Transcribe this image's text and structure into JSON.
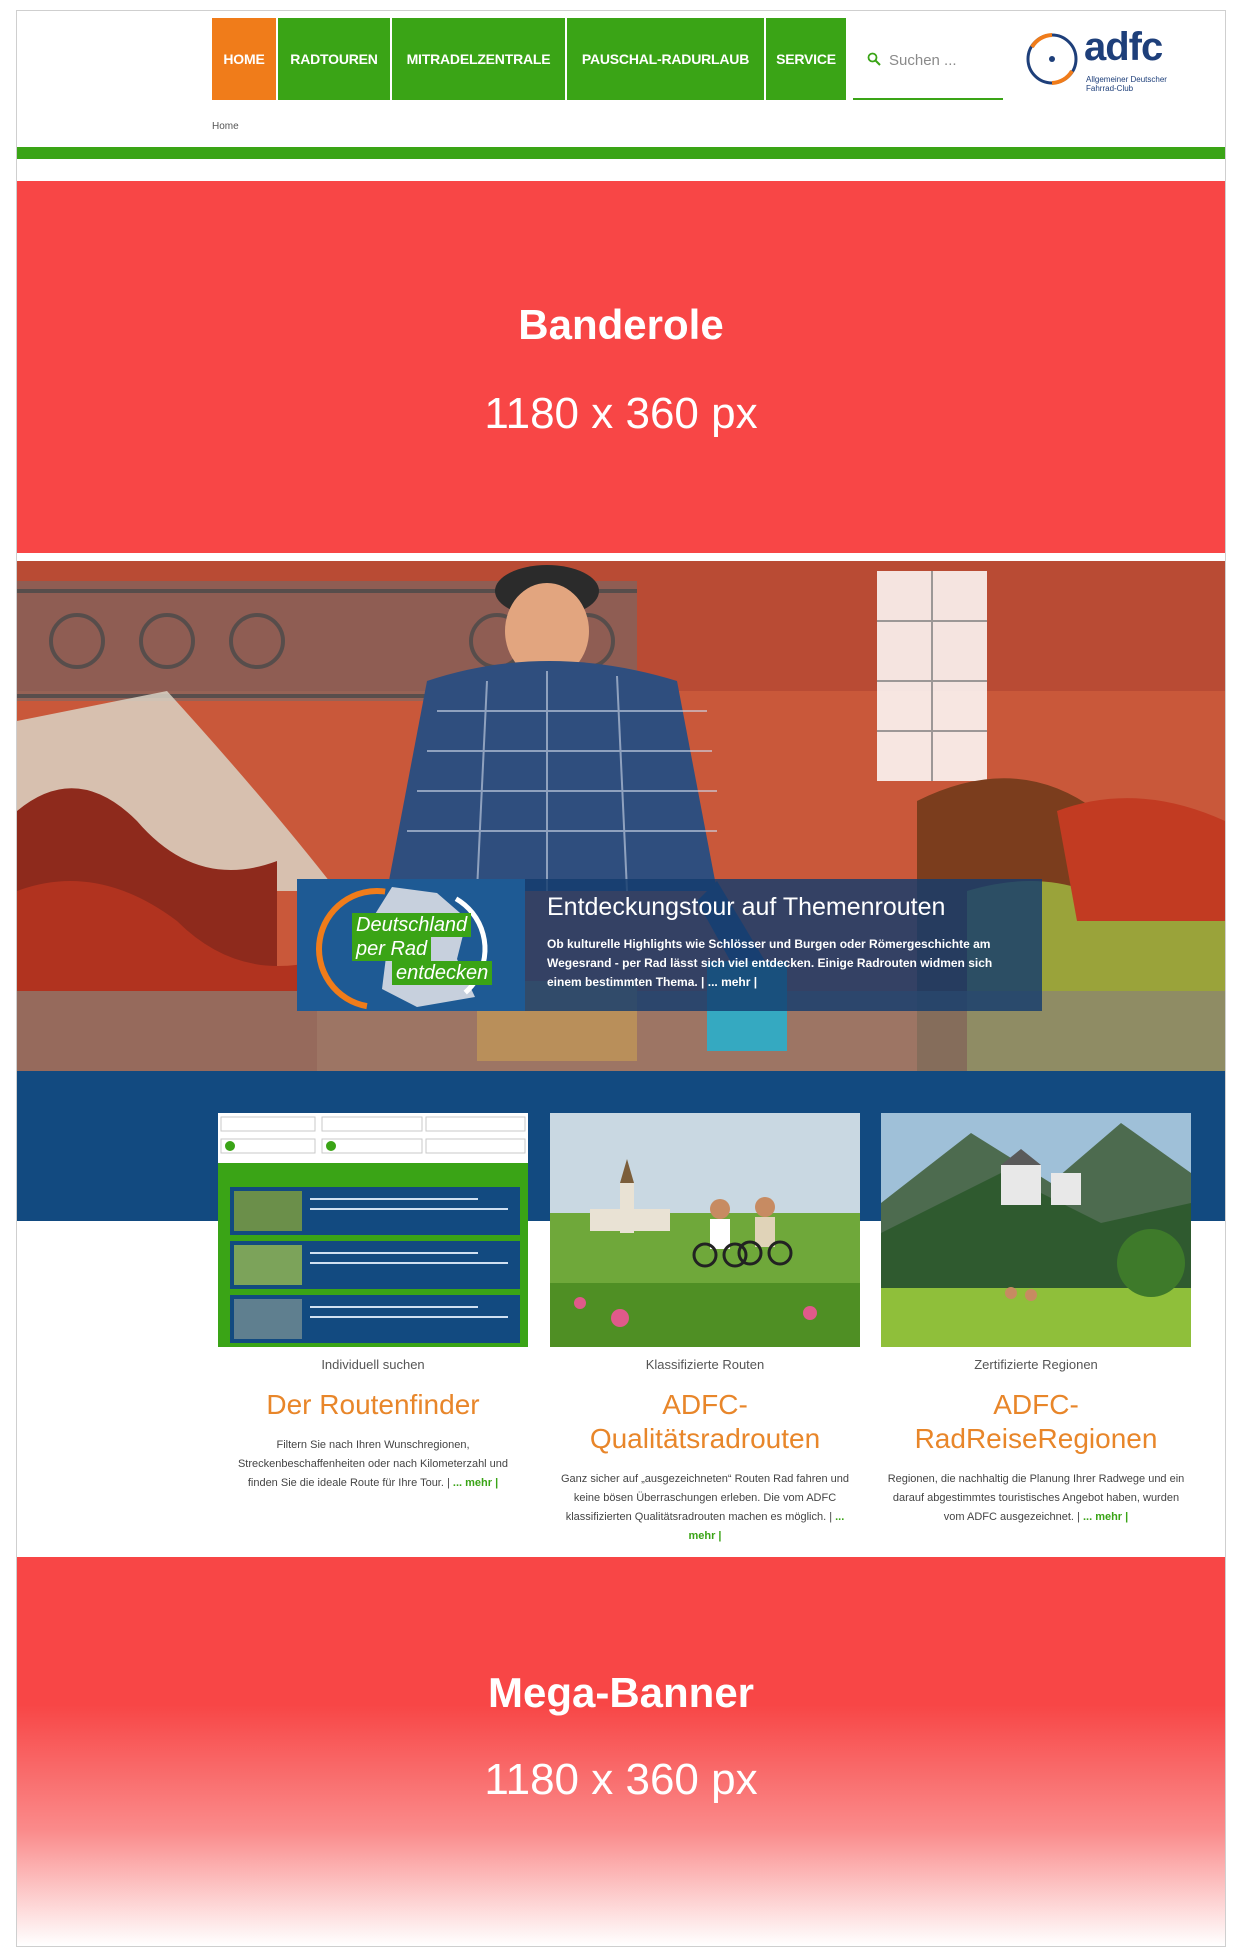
{
  "nav": {
    "items": [
      {
        "label": "HOME",
        "active": true
      },
      {
        "label": "RADTOUREN"
      },
      {
        "label": "MITRADELZENTRALE"
      },
      {
        "label": "PAUSCHAL-RADURLAUB"
      },
      {
        "label": "SERVICE"
      }
    ],
    "search_placeholder": "Suchen ...",
    "search_icon": "search-icon"
  },
  "logo": {
    "word": "adfc",
    "subtitle": "Allgemeiner Deutscher Fahrrad-Club"
  },
  "breadcrumb": "Home",
  "ad_top": {
    "title": "Banderole",
    "size": "1180 x 360 px"
  },
  "hero": {
    "badge_lines": [
      "Deutschland",
      "per Rad",
      "entdecken"
    ],
    "heading": "Entdeckungstour auf Themenrouten",
    "text": "Ob kulturelle Highlights wie Schlösser und Burgen oder Römergeschichte am Wegesrand - per Rad lässt sich viel entdecken. Einige Radrouten widmen sich einem bestimmten Thema. | ... mehr |"
  },
  "cards": [
    {
      "kicker": "Individuell suchen",
      "heading": "Der Routenfinder",
      "text": "Filtern Sie nach Ihren Wunschregionen, Streckenbeschaffenheiten oder nach Kilometerzahl und finden Sie die ideale Route für Ihre Tour. |",
      "more": "... mehr |"
    },
    {
      "kicker": "Klassifizierte Routen",
      "heading": "ADFC-Qualitätsradrouten",
      "text": "Ganz sicher auf „ausgezeichneten“ Routen Rad fahren und keine bösen Überraschungen erleben. Die vom ADFC klassifizierten Qualitätsradrouten machen es möglich. |",
      "more": "... mehr |"
    },
    {
      "kicker": "Zertifizierte Regionen",
      "heading": "ADFC-RadReiseRegionen",
      "text": "Regionen, die nachhaltig die Planung Ihrer Radwege und ein darauf abgestimmtes touristisches Angebot haben, wurden vom ADFC ausgezeichnet. |",
      "more": "... mehr |"
    }
  ],
  "ad_bottom": {
    "title": "Mega-Banner",
    "size": "1180 x 360 px"
  }
}
